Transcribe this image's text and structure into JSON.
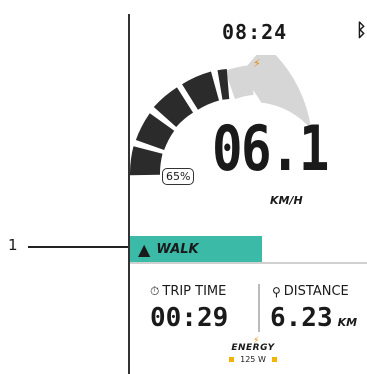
{
  "callout": {
    "number": "1"
  },
  "status_bar": {
    "time": "08:24",
    "bluetooth_icon": "bluetooth-icon"
  },
  "gauge": {
    "speed": "06.1",
    "unit": "KM/H",
    "battery": "65%",
    "colors": {
      "filled": "#2b2b2b",
      "empty": "#d6d6d6"
    }
  },
  "mode": {
    "label": "WALK",
    "icon": "walking-shoe-icon",
    "color": "#3bbaa8"
  },
  "stats": {
    "trip_time": {
      "label": "TRIP TIME",
      "value": "00:29",
      "icon": "stopwatch-icon"
    },
    "distance": {
      "label": "DISTANCE",
      "value": "6.23",
      "unit": "KM",
      "icon": "route-icon"
    }
  },
  "energy": {
    "label": "ENERGY",
    "value": "125 W",
    "icon": "lightning-icon"
  }
}
